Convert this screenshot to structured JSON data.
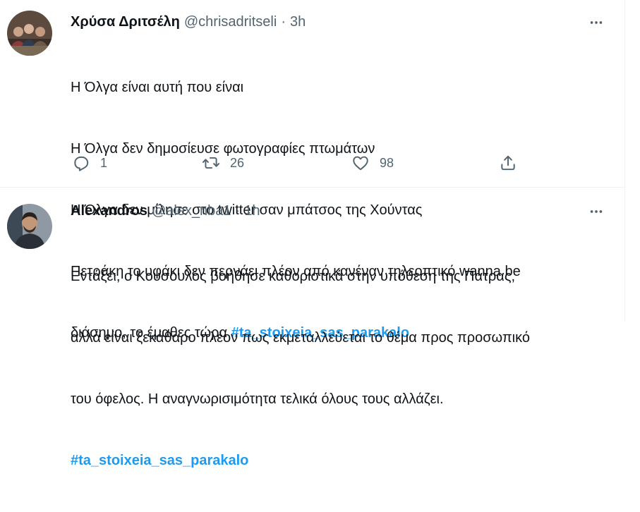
{
  "tweets": [
    {
      "display_name": "Χρύσα Δριτσέλη",
      "handle": "@chrisadritseli",
      "separator": "·",
      "time": "3h",
      "lines": [
        "Η Όλγα είναι αυτή που είναι",
        "Η Όλγα δεν δημοσίευσε φωτογραφίες πτωμάτων",
        "Η Όλγα δεν μίλησε στο twitter σαν μπάτσος της Χούντας",
        "Πετράκη το υφάκι δεν περνάει πλέον από κανέναν τηλεοπτικό wanna be",
        "διάσημο, το έμαθες τώρα "
      ],
      "hashtag": "#ta_stoixeia_sas_parakalo",
      "reply_count": "1",
      "retweet_count": "26",
      "like_count": "98",
      "avatar_icon": "avatar-group-photo-icon"
    },
    {
      "display_name": "Alexandros",
      "handle": "@alex_nba1",
      "separator": "·",
      "time": "1h",
      "lines": [
        "Εντάξει, ο Κουσουλός βοήθησε καθοριστικά στην υπόθεση της Πάτρας,",
        "αλλά είναι ξεκάθαρο πλέον πως εκμεταλλεύεται το θέμα προς προσωπικό",
        "του όφελος. Η αναγνωρισιμότητα τελικά όλους τους αλλάζει."
      ],
      "hashtag": "#ta_stoixeia_sas_parakalo",
      "avatar_icon": "avatar-person-photo-icon"
    }
  ],
  "icons": {
    "reply": "reply-icon",
    "retweet": "retweet-icon",
    "like": "heart-icon",
    "share": "share-icon",
    "more": "more-options-icon"
  },
  "colors": {
    "link": "#1d9bf0",
    "secondary_text": "#536471",
    "primary_text": "#0f1419",
    "divider": "#eff3f4"
  }
}
